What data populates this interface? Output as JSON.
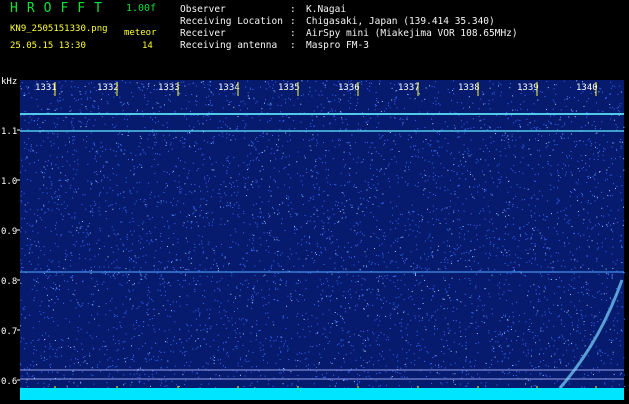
{
  "header": {
    "brand": "HROFFT",
    "version": "1.00f",
    "filename": "KN9_2505151330.png",
    "datetime": "25.05.15 13:30",
    "meteor_label": "meteor",
    "meteor_count": "14"
  },
  "info": [
    {
      "key": "Observer",
      "value": "K.Nagai"
    },
    {
      "key": "Receiving Location",
      "value": "Chigasaki, Japan (139.414 35.340)"
    },
    {
      "key": "Receiver",
      "value": "AirSpy mini (Miakejima VOR 108.65MHz)"
    },
    {
      "key": "Receiving antenna",
      "value": "Maspro FM-3"
    }
  ],
  "spectrogram": {
    "y_unit": "kHz",
    "y_ticks": [
      "1.1",
      "1.0",
      "0.9",
      "0.8",
      "0.7",
      "0.6"
    ],
    "x_ticks": [
      "1331",
      "1332",
      "1333",
      "1334",
      "1335",
      "1336",
      "1337",
      "1338",
      "1339",
      "1340"
    ],
    "colors": {
      "background": "#061a6e",
      "noise": "#3a6cff",
      "signal": "#5ee8ff",
      "tick": "#ffff33",
      "baseline": "#00e5ff"
    }
  }
}
